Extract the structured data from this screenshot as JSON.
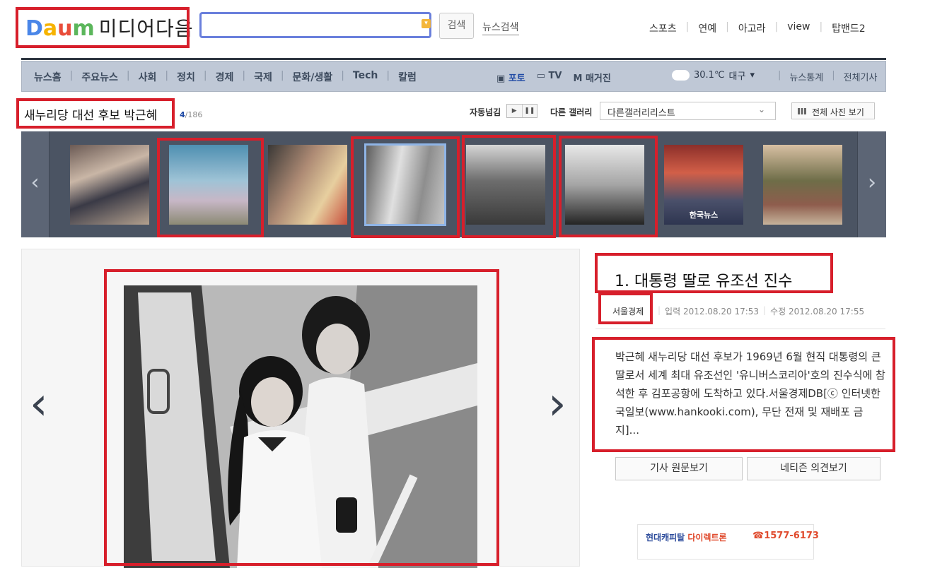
{
  "header": {
    "logo_letters": [
      "D",
      "a",
      "u",
      "m"
    ],
    "logo_text": "미디어다음",
    "search_placeholder": "",
    "search_button": "검색",
    "news_search_link": "뉴스검색",
    "top_links": [
      "스포츠",
      "연예",
      "아고라",
      "view",
      "탑밴드2"
    ]
  },
  "nav": {
    "items": [
      "뉴스홈",
      "주요뉴스",
      "사회",
      "정치",
      "경제",
      "국제",
      "문화/생활",
      "Tech",
      "칼럼"
    ],
    "media_items": [
      "포토",
      "TV",
      "매거진"
    ],
    "active_item": "포토",
    "weather": {
      "temp": "30.1℃",
      "city": "대구"
    },
    "right_links": [
      "뉴스통계",
      "전체기사"
    ]
  },
  "gallery": {
    "title": "새누리당 대선 후보 박근혜",
    "current": "4",
    "total": "/186",
    "auto_label": "자동넘김",
    "other_label": "다른 갤러리",
    "select_value": "다른갤러리리스트",
    "view_all": "전체 사진 보기",
    "thumbs": [
      {
        "label": ""
      },
      {
        "label": ""
      },
      {
        "label": ""
      },
      {
        "label": ""
      },
      {
        "label": ""
      },
      {
        "label": ""
      },
      {
        "label": "한국뉴스"
      },
      {
        "label": ""
      }
    ],
    "selected_index": 3
  },
  "article": {
    "title": "1. 대통령 딸로 유조선 진수",
    "source": "서울경제",
    "input_date": "입력 2012.08.20 17:53",
    "edit_date": "수정 2012.08.20 17:55",
    "body": "박근혜 새누리당 대선 후보가 1969년 6월 현직 대통령의 큰 딸로서 세계 최대 유조선인 '유니버스코리아'호의 진수식에 참석한 후 김포공항에 도착하고 있다.서울경제DB[ⓒ 인터넷한국일보(www.hankooki.com), 무단 전재 및 재배포 금지]...",
    "btn_original": "기사 원문보기",
    "btn_comments": "네티즌 의견보기"
  },
  "ad": {
    "name_prefix": "현대캐피탈",
    "name_suffix": "다이렉트론",
    "phone": "☎1577-6173"
  },
  "colors": {
    "annotation_red": "#d71f2b",
    "nav_bg": "#bfc8d6",
    "strip_bg": "#4b5463",
    "link_blue": "#1f4aa5"
  }
}
